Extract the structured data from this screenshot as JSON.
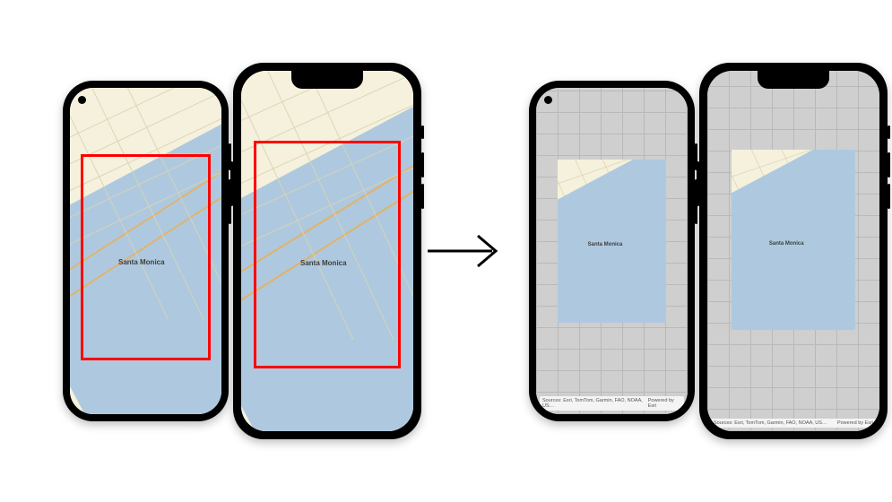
{
  "figure": {
    "description": "Two pairs of smartphone mockups illustrating a map view before and after applying a visible-extent/inset constraint. Left pair shows full-screen Santa Monica map with a red rectangle marking the target extent. Right pair shows the same devices with a grey tile grid background and the map content letterboxed to match that extent.",
    "arrow_direction": "left-to-right"
  },
  "devices": {
    "left_android": {
      "type": "Android",
      "screen_state": "full-map",
      "highlight": "red-rectangle"
    },
    "left_iphone": {
      "type": "iPhone",
      "screen_state": "full-map",
      "highlight": "red-rectangle"
    },
    "right_android": {
      "type": "Android",
      "screen_state": "inset-map-on-grey-grid"
    },
    "right_iphone": {
      "type": "iPhone",
      "screen_state": "inset-map-on-grey-grid"
    }
  },
  "map": {
    "place_label": "Santa Monica",
    "land_color": "#f5f1dc",
    "ocean_color": "#aec9df",
    "highlight_color": "#ff0000"
  },
  "attribution": {
    "sources": "Sources: Esri, TomTom, Garmin, FAO, NOAA, US…",
    "powered": "Powered by Esri"
  }
}
